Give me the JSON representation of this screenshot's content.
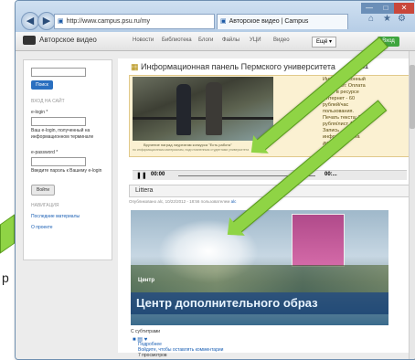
{
  "browser": {
    "url": "http://www.campus.psu.ru/my",
    "tab_title": "Авторское видео | Campus"
  },
  "site": {
    "name": "Авторское видео",
    "menu": [
      "Новости",
      "Библиотека",
      "Блоги",
      "Файлы",
      "УЦИ",
      "Видео"
    ],
    "more": "Ещё ▾",
    "login": "Вход"
  },
  "sidebar": {
    "search_button": "Поиск",
    "login_heading": "ВХОД НА САЙТ",
    "elogin_label": "e-login *",
    "elogin_hint": "Ваш e-login, полученный на информационном терминале",
    "epassword_label": "e-password *",
    "epassword_hint": "Введите пароль к Вашему e-login",
    "login_button": "Войти",
    "nav_heading": "НАВИГАЦИЯ",
    "nav_links": [
      "Последние материалы",
      "О проекте"
    ]
  },
  "panel": {
    "title_prefix": "Информационная панель",
    "title_suffix": "Пермского университета",
    "time": "20:41",
    "caption_main": "Вручение наград лауреатам конкурса \"Есть работа\"",
    "caption_sub": "по информационным материалам, подготовленным студентами университета",
    "side_text": "Информационный терминал: Оплата услуг в ресурсе Интернет - 60 рублей/час пользования. Печать текста: 3 рубля/лист А4. Запись информации на диски",
    "time_start": "00:00",
    "time_end": "00:..."
  },
  "article": {
    "title": "Littera",
    "meta": "Опубликовано alc, 10/22/2012 - 18:56 пользователем",
    "meta_author": "alc",
    "overlay_title": "Центр дополнительного образ",
    "overlay_small": "Центр",
    "subtitle": "С субтитрами",
    "links": [
      "Подробнее",
      "Войдите, чтобы оставлять комментарии",
      "7 просмотров"
    ]
  },
  "overlay": {
    "left_char": "р"
  }
}
